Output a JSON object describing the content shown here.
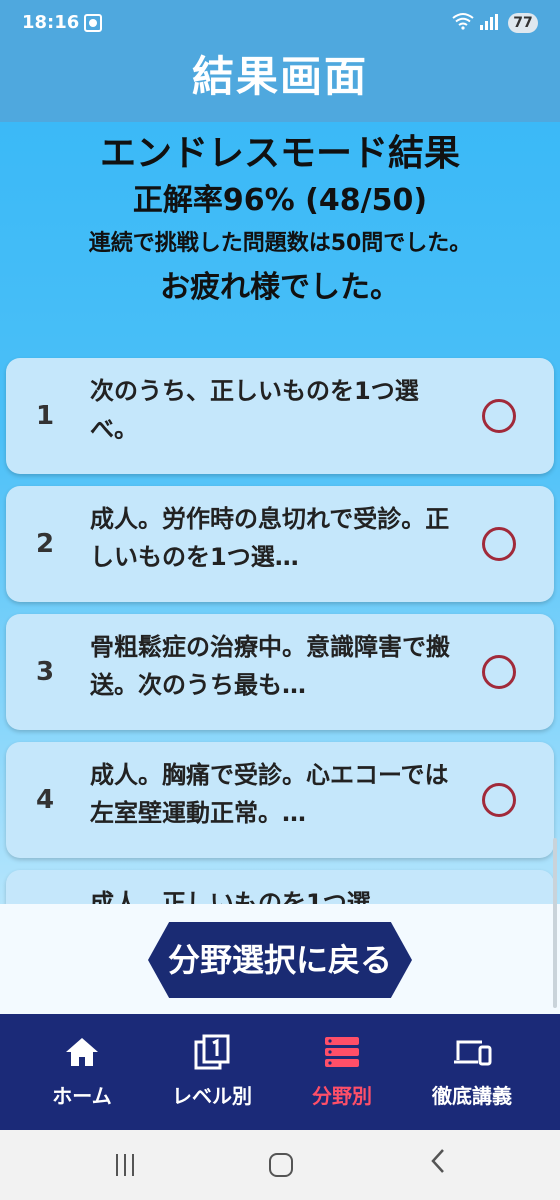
{
  "status": {
    "time": "18:16",
    "battery": "77"
  },
  "appbar": {
    "title": "結果画面"
  },
  "summary": {
    "mode_title": "エンドレスモード結果",
    "accuracy": "正解率96% (48/50)",
    "count_text": "連続で挑戦した問題数は50問でした。",
    "thanks": "お疲れ様でした。"
  },
  "results": [
    {
      "num": "1",
      "text": "次のうち、正しいものを1つ選べ。",
      "mark": "correct"
    },
    {
      "num": "2",
      "text": "成人。労作時の息切れで受診。正しいものを1つ選…",
      "mark": "correct"
    },
    {
      "num": "3",
      "text": "骨粗鬆症の治療中。意識障害で搬送。次のうち最も…",
      "mark": "correct"
    },
    {
      "num": "4",
      "text": "成人。胸痛で受診。心エコーでは左室壁運動正常。…",
      "mark": "correct"
    },
    {
      "num": "",
      "text": "成人。正しいものを1つ選",
      "mark": "correct"
    }
  ],
  "back_button": {
    "label": "分野選択に戻る"
  },
  "tabs": [
    {
      "label": "ホーム",
      "icon": "home-icon"
    },
    {
      "label": "レベル別",
      "icon": "level-icon"
    },
    {
      "label": "分野別",
      "icon": "category-icon",
      "active": true
    },
    {
      "label": "徹底講義",
      "icon": "devices-icon"
    }
  ],
  "colors": {
    "header": "#4fa8de",
    "tabbar": "#1b2a78",
    "active_tab": "#ff4f68",
    "mark": "#a12a3a"
  }
}
